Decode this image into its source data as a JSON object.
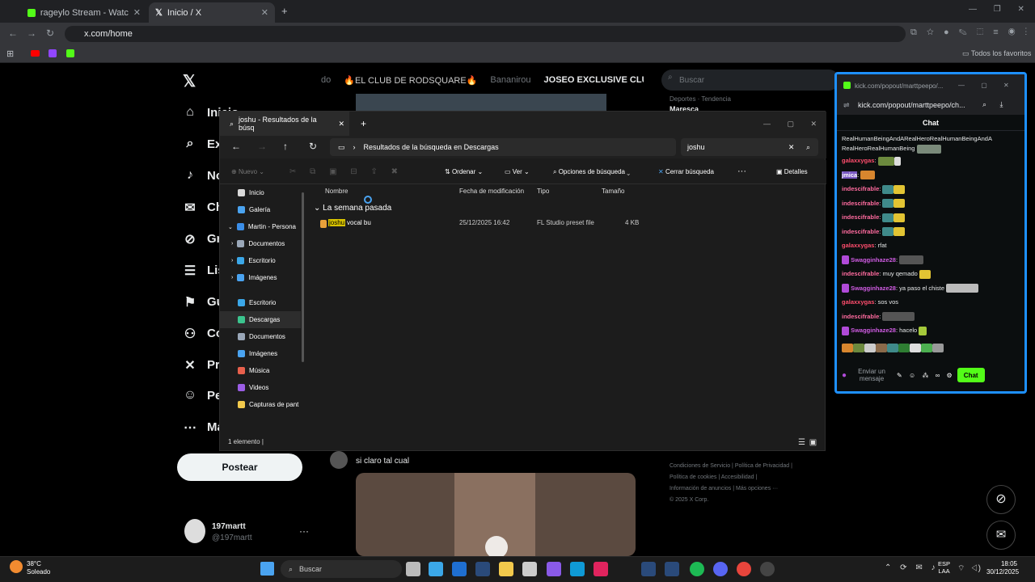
{
  "browser": {
    "tabs": [
      {
        "label": "rageylo Stream - Watch Live on",
        "active": false
      },
      {
        "label": "Inicio / X",
        "active": true
      }
    ],
    "url": "x.com/home",
    "bookmarks_label": "Todos los favoritos"
  },
  "x_sidebar": {
    "items": [
      {
        "label": "Inicio",
        "icon": "home-icon"
      },
      {
        "label": "Ex",
        "icon": "search-icon"
      },
      {
        "label": "No",
        "icon": "bell-icon"
      },
      {
        "label": "Ch",
        "icon": "mail-icon"
      },
      {
        "label": "Gr",
        "icon": "grok-icon"
      },
      {
        "label": "Lis",
        "icon": "list-icon"
      },
      {
        "label": "Gu",
        "icon": "bookmark-icon"
      },
      {
        "label": "Co",
        "icon": "communities-icon"
      },
      {
        "label": "Pr",
        "icon": "x-icon"
      },
      {
        "label": "Pe",
        "icon": "person-icon"
      },
      {
        "label": "Ma",
        "icon": "more-icon"
      }
    ],
    "post_button": "Postear",
    "profile": {
      "name": "197martt",
      "handle": "@197martt"
    }
  },
  "center": {
    "tabs_strip": [
      "do",
      "🔥EL CLUB DE RODSQUARE🔥",
      "Bananirou",
      "JOSEO EXCLUSIVE CLUB"
    ],
    "tweet_text": "si claro tal cual"
  },
  "right": {
    "search_placeholder": "Buscar",
    "trend_label": "Deportes · Tendencia",
    "trend_title": "Maresca",
    "footer_links": [
      "Condiciones de Servicio",
      "Política de Privacidad",
      "Política de cookies",
      "Accesibilidad",
      "Información de anuncios",
      "Más opciones ···",
      "© 2025 X Corp."
    ]
  },
  "explorer": {
    "title": "joshu - Resultados de la búsq",
    "breadcrumb": "Resultados de la búsqueda en Descargas",
    "search_value": "joshu",
    "toolbar": {
      "new": "Nuevo",
      "sort": "Ordenar",
      "view": "Ver",
      "search_options": "Opciones de búsqueda",
      "close_search": "Cerrar búsqueda",
      "details": "Detalles"
    },
    "sidebar": [
      {
        "label": "Inicio",
        "color": "#d9d9d9"
      },
      {
        "label": "Galería",
        "color": "#4aa3f0"
      },
      {
        "label": "Martin - Persona",
        "color": "#3b8ee8"
      },
      {
        "label": "Documentos",
        "color": "#9aa7b8"
      },
      {
        "label": "Escritorio",
        "color": "#3ba7e8"
      },
      {
        "label": "Imágenes",
        "color": "#4aa3f0"
      },
      {
        "label": "Escritorio",
        "color": "#3ba7e8"
      },
      {
        "label": "Descargas",
        "color": "#3bc48e"
      },
      {
        "label": "Documentos",
        "color": "#9aa7b8"
      },
      {
        "label": "Imágenes",
        "color": "#4aa3f0"
      },
      {
        "label": "Música",
        "color": "#e8604c"
      },
      {
        "label": "Videos",
        "color": "#9b5de5"
      },
      {
        "label": "Capturas de pant",
        "color": "#f2c94c"
      }
    ],
    "columns": [
      "Nombre",
      "Fecha de modificación",
      "Tipo",
      "Tamaño"
    ],
    "group": "La semana pasada",
    "file": {
      "name_highlight": "joshu",
      "name_rest": "vocal bu",
      "date": "25/12/2025 16:42",
      "type": "FL Studio preset file",
      "size": "4 KB"
    },
    "status": "1 elemento"
  },
  "kick": {
    "window_title": "kick.com/popout/marttpeepo/...",
    "url": "kick.com/popout/marttpeepo/ch...",
    "chat_header": "Chat",
    "messages": [
      {
        "user": "",
        "text": "RealHumanBeingAndARealHeroRealHumanBeingAndA",
        "cls": "u1"
      },
      {
        "user": "",
        "text": "RealHeroRealHumanBeing",
        "cls": "u1"
      },
      {
        "user": "galaxxygas",
        "text": "",
        "cls": "u3"
      },
      {
        "user": "jmica",
        "text": "",
        "cls": "u2"
      },
      {
        "user": "indescifrable",
        "text": "",
        "cls": "u1"
      },
      {
        "user": "indescifrable",
        "text": "",
        "cls": "u1"
      },
      {
        "user": "indescifrable",
        "text": "",
        "cls": "u1"
      },
      {
        "user": "indescifrable",
        "text": "",
        "cls": "u1"
      },
      {
        "user": "galaxxygas",
        "text": "rfat",
        "cls": "u3"
      },
      {
        "user": "Swagginhaze28",
        "text": "",
        "cls": "u2"
      },
      {
        "user": "indescifrable",
        "text": "muy qemado",
        "cls": "u1"
      },
      {
        "user": "Swagginhaze28",
        "text": "ya paso el chiste",
        "cls": "u2"
      },
      {
        "user": "galaxxygas",
        "text": "sos vos",
        "cls": "u3"
      },
      {
        "user": "indescifrable",
        "text": "",
        "cls": "u1"
      },
      {
        "user": "Swagginhaze28",
        "text": "hacelo",
        "cls": "u2"
      }
    ],
    "input_placeholder": "Enviar un mensaje",
    "send_label": "Chat",
    "accent": "#53fc18"
  },
  "taskbar": {
    "weather_temp": "38°C",
    "weather_desc": "Soleado",
    "search_label": "Buscar",
    "lang_1": "ESP",
    "lang_2": "LAA",
    "time": "18:05",
    "date": "30/12/2025"
  }
}
